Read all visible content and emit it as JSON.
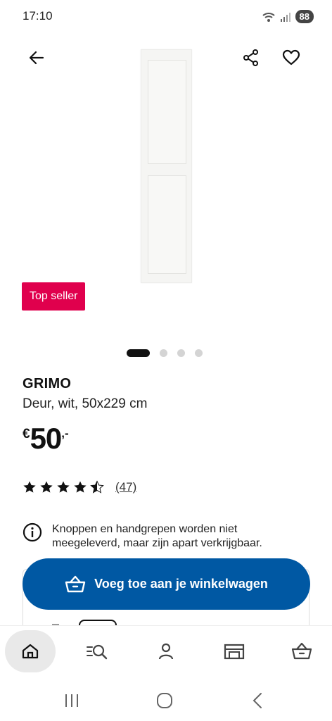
{
  "status": {
    "time": "17:10",
    "battery": "88"
  },
  "header": {
    "back_icon": "arrow-left-icon",
    "share_icon": "share-icon",
    "favorite_icon": "heart-icon"
  },
  "product": {
    "badge": "Top seller",
    "carousel": {
      "pages": 4,
      "active": 1
    },
    "name": "GRIMO",
    "description": "Deur, wit, 50x229 cm",
    "price": {
      "currency": "€",
      "amount": "50",
      "cents": ",-"
    },
    "rating": {
      "stars": 4.5,
      "max": 5,
      "count_label": "(47)"
    },
    "notice": "Knoppen en handgrepen worden niet meegeleverd, maar zijn apart verkrijgbaar."
  },
  "actions": {
    "add_to_cart": "Voeg toe aan je winkelwagen"
  },
  "bottom_nav": {
    "items": [
      {
        "icon": "home-icon",
        "active": true
      },
      {
        "icon": "search-list-icon",
        "active": false
      },
      {
        "icon": "profile-icon",
        "active": false
      },
      {
        "icon": "store-icon",
        "active": false
      },
      {
        "icon": "basket-icon",
        "active": false
      }
    ]
  },
  "system_nav": {
    "items": [
      "recents-icon",
      "home-circle-icon",
      "back-chevron-icon"
    ]
  },
  "colors": {
    "brand_blue": "#0058a3",
    "badge_red": "#e0004d"
  }
}
